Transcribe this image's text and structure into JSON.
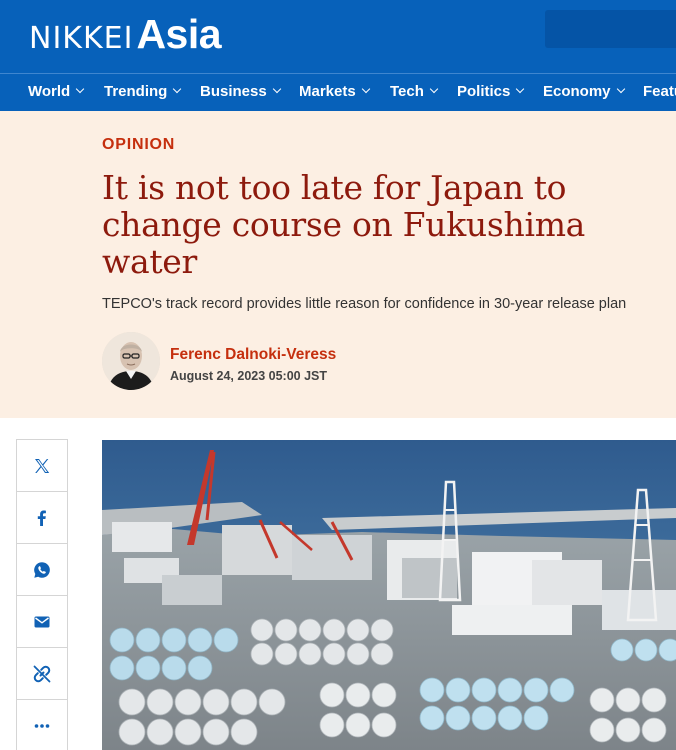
{
  "header": {
    "logo_main": "NIKKEI",
    "logo_accent": "Asia"
  },
  "nav": {
    "items": [
      {
        "label": "World"
      },
      {
        "label": "Trending"
      },
      {
        "label": "Business"
      },
      {
        "label": "Markets"
      },
      {
        "label": "Tech"
      },
      {
        "label": "Politics"
      },
      {
        "label": "Economy"
      },
      {
        "label": "Featu"
      }
    ]
  },
  "article": {
    "kicker": "OPINION",
    "headline": "It is not too late for Japan to change course on Fukushima water",
    "standfirst": "TEPCO's track record provides little reason for confidence in 30-year release plan",
    "author": "Ferenc Dalnoki-Veress",
    "date": "August 24, 2023 05:00 JST"
  },
  "share": {
    "icons": [
      "x-icon",
      "facebook-icon",
      "whatsapp-icon",
      "email-icon",
      "copy-link-icon",
      "more-icon"
    ]
  },
  "colors": {
    "brand_blue": "#0761ba",
    "opinion_red": "#c52f0e",
    "headline_red": "#8d1a0d",
    "header_bg": "#fcefe3"
  }
}
